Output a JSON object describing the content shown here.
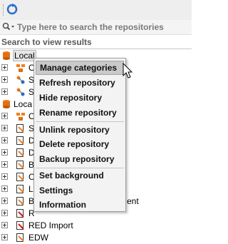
{
  "search": {
    "placeholder": "Type here to search the repositories"
  },
  "results_label": "Search to view results",
  "tree": [
    {
      "label": "Local",
      "icon": "database-icon"
    },
    {
      "label": "O",
      "icon": "category-icon"
    },
    {
      "label": "S",
      "icon": "source-icon"
    },
    {
      "label": "S",
      "icon": "source-icon"
    },
    {
      "label": "Loca",
      "icon": "database-icon"
    },
    {
      "label": "O",
      "icon": "category-icon"
    },
    {
      "label": "S",
      "icon": "repository-icon"
    },
    {
      "label": "D",
      "icon": "repository-icon"
    },
    {
      "label": "D",
      "icon": "repository-icon"
    },
    {
      "label": "B",
      "icon": "repository-icon"
    },
    {
      "label": "C",
      "icon": "repository-icon"
    },
    {
      "label": "L",
      "icon": "repository-icon"
    },
    {
      "label": "B",
      "icon": "repository-icon",
      "trailing": "ent"
    },
    {
      "label": "R",
      "icon": "red-repository-icon"
    },
    {
      "label": "RED Import",
      "icon": "red-repository-icon"
    },
    {
      "label": "EDW",
      "icon": "repository-icon"
    }
  ],
  "context_menu": {
    "items": [
      "Manage categories",
      "Refresh repository",
      "Hide repository",
      "Rename repository",
      "Unlink repository",
      "Delete repository",
      "Backup repository",
      "Set background",
      "Settings",
      "Information"
    ],
    "hovered": "Manage categories"
  },
  "colors": {
    "accent": "#f08020",
    "link_blue": "#2a6fc9"
  }
}
